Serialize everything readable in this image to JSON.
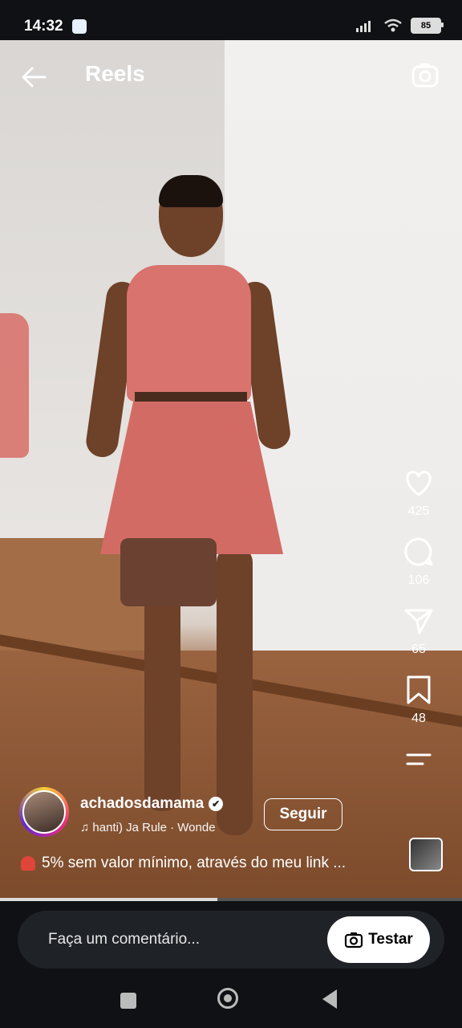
{
  "status_bar": {
    "time": "14:32",
    "battery": "85"
  },
  "header": {
    "title": "Reels"
  },
  "actions": {
    "likes": "425",
    "comments": "106",
    "shares": "65",
    "saves": "48"
  },
  "post": {
    "username": "achadosdamama",
    "verified_mark": "✔",
    "music": "♫  hanti)   Ja Rule · Wonde",
    "follow_label": "Seguir",
    "caption": "5% sem valor mínimo, através do meu link ..."
  },
  "progress_fraction": 0.47,
  "comment": {
    "placeholder": "Faça um comentário...",
    "try_label": "Testar"
  },
  "colors": {
    "background": "#0f1114",
    "button": "#ffffff"
  }
}
